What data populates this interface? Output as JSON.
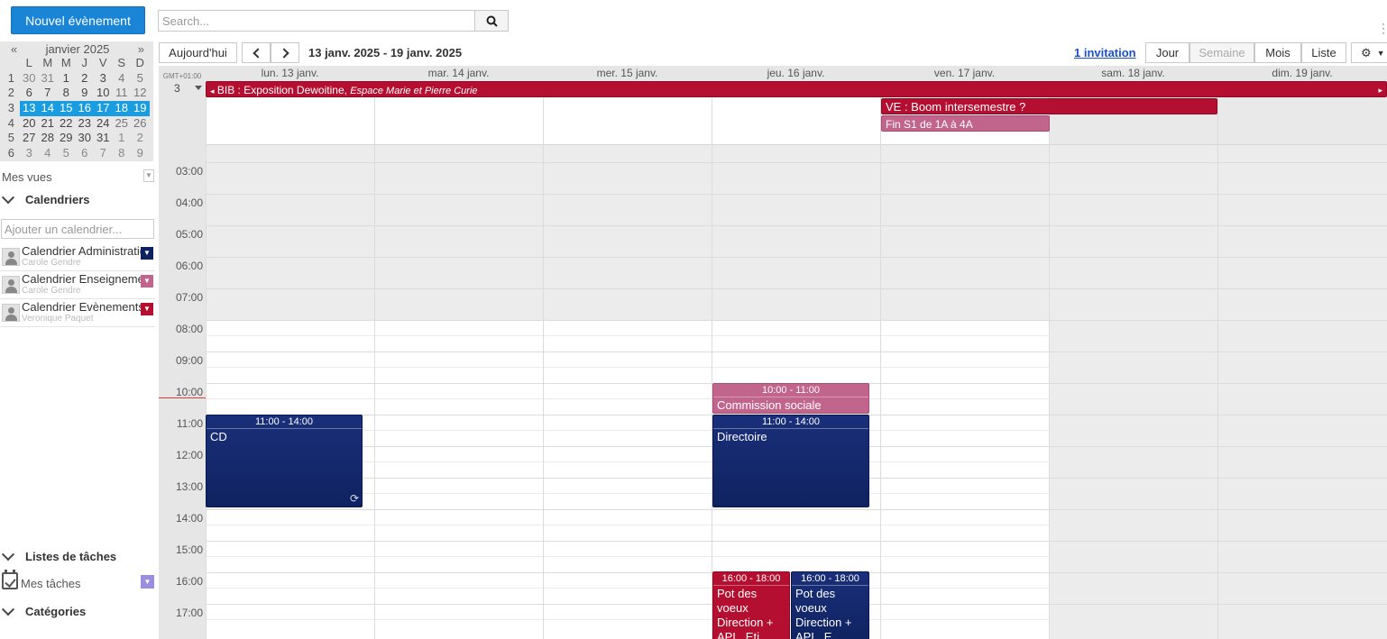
{
  "header": {
    "new_event_label": "Nouvel évènement",
    "search_placeholder": "Search..."
  },
  "mini_calendar": {
    "month_label": "janvier 2025",
    "prev_label": "«",
    "next_label": "»",
    "weekday_headers": [
      "L",
      "M",
      "M",
      "J",
      "V",
      "S",
      "D"
    ],
    "weeks": [
      {
        "week": "1",
        "days": [
          "30",
          "31",
          "1",
          "2",
          "3",
          "4",
          "5"
        ]
      },
      {
        "week": "2",
        "days": [
          "6",
          "7",
          "8",
          "9",
          "10",
          "11",
          "12"
        ]
      },
      {
        "week": "3",
        "days": [
          "13",
          "14",
          "15",
          "16",
          "17",
          "18",
          "19"
        ]
      },
      {
        "week": "4",
        "days": [
          "20",
          "21",
          "22",
          "23",
          "24",
          "25",
          "26"
        ]
      },
      {
        "week": "5",
        "days": [
          "27",
          "28",
          "29",
          "30",
          "31",
          "1",
          "2"
        ]
      },
      {
        "week": "6",
        "days": [
          "3",
          "4",
          "5",
          "6",
          "7",
          "8",
          "9"
        ]
      }
    ],
    "selected_week": "3"
  },
  "sidebar": {
    "my_views_label": "Mes vues",
    "calendars_title": "Calendriers",
    "add_calendar_placeholder": "Ajouter un calendrier...",
    "calendars": [
      {
        "name": "Calendrier Administration",
        "owner": "Carole Gendre",
        "color": "#0f2260"
      },
      {
        "name": "Calendrier Enseignement",
        "owner": "Carole Gendre",
        "color": "#c2658c"
      },
      {
        "name": "Calendrier Evènements",
        "owner": "Veronique Paquet",
        "color": "#b40e30"
      }
    ],
    "task_lists_title": "Listes de tâches",
    "my_tasks_label": "Mes tâches",
    "my_tasks_color": "#9b8ee0",
    "categories_title": "Catégories"
  },
  "toolbar": {
    "today_label": "Aujourd'hui",
    "date_range": "13 janv. 2025 - 19 janv. 2025",
    "invitation_label": "1 invitation",
    "views": [
      "Jour",
      "Semaine",
      "Mois",
      "Liste"
    ],
    "active_view": "Semaine"
  },
  "grid": {
    "timezone": "GMT+01:00",
    "allday_count": "3",
    "days": [
      "lun. 13 janv.",
      "mar. 14 janv.",
      "mer. 15 janv.",
      "jeu. 16 janv.",
      "ven. 17 janv.",
      "sam. 18 janv.",
      "dim. 19 janv."
    ],
    "hours": [
      "03:00",
      "04:00",
      "05:00",
      "06:00",
      "07:00",
      "08:00",
      "09:00",
      "10:00",
      "11:00",
      "12:00",
      "13:00",
      "14:00",
      "15:00",
      "16:00",
      "17:00"
    ]
  },
  "allday_events": {
    "bib_title": "BIB : Exposition Dewoitine,",
    "bib_location": "Espace Marie et Pierre Curie",
    "boom_title": "VE : Boom intersemestre ?",
    "fin_title": "Fin S1 de 1A à 4A"
  },
  "events": {
    "cd": {
      "time": "11:00 - 14:00",
      "title": "CD"
    },
    "commission": {
      "time": "10:00 - 11:00",
      "title": "Commission sociale"
    },
    "directoire": {
      "time": "11:00 - 14:00",
      "title": "Directoire"
    },
    "pot1": {
      "time": "16:00 - 18:00",
      "title": "Pot des voeux Direction + APL, Eti"
    },
    "pot2": {
      "time": "16:00 - 18:00",
      "title": "Pot des voeux Direction + APL, E"
    }
  },
  "colors": {
    "accent": "#1a85d6",
    "selection": "#1a9de0",
    "navy": "#0f2260",
    "crimson": "#b40e30",
    "pink": "#c2658c"
  }
}
